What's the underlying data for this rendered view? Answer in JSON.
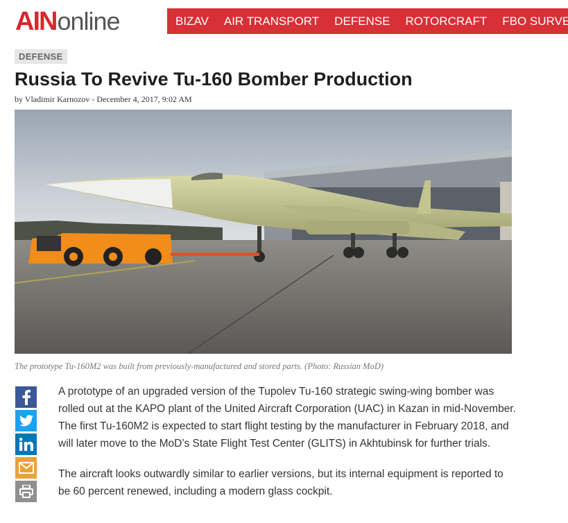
{
  "site": {
    "logo_part1": "AIN",
    "logo_part2": "online",
    "brand_color": "#d8272e"
  },
  "nav": {
    "items": [
      "BIZAV",
      "AIR TRANSPORT",
      "DEFENSE",
      "ROTORCRAFT",
      "FBO SURVEY"
    ],
    "background": "#d73036"
  },
  "article": {
    "category": "DEFENSE",
    "title": "Russia To Revive Tu-160 Bomber Production",
    "byline": "by Vladimir Karnozov - December 4, 2017, 9:02 AM",
    "caption": "The prototype Tu-160M2 was built from previously-manufactured and stored parts. (Photo: Russian MoD)",
    "paragraphs": [
      "A prototype of an upgraded version of the Tupolev Tu-160 strategic swing-wing bomber was rolled out at the KAPO plant of the United Aircraft Corporation (UAC) in Kazan in mid-November. The first Tu-160M2 is expected to start flight testing by the manufacturer in February 2018, and will later move to the MoD’s State Flight Test Center (GLITS) in Akhtubinsk for further trials.",
      "The aircraft looks outwardly similar to earlier versions, but its internal equipment is reported to be 60 percent renewed, including a modern glass cockpit."
    ]
  },
  "share": {
    "icons": [
      "facebook-icon",
      "twitter-icon",
      "linkedin-icon",
      "email-icon",
      "print-icon"
    ],
    "colors": [
      "#3b5998",
      "#1da1f2",
      "#0077b5",
      "#e8a23a",
      "#8f8f8f"
    ]
  }
}
